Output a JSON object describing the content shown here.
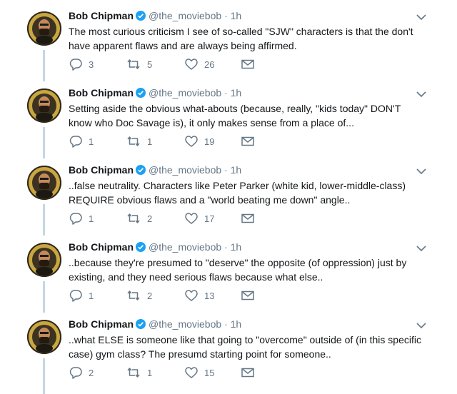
{
  "colors": {
    "accent": "#1da1f2",
    "connector": "#c4d7e4",
    "muted": "#657786"
  },
  "author": {
    "name": "Bob Chipman",
    "handle": "@the_moviebob",
    "separator": "·"
  },
  "icons": {
    "reply": "reply-icon",
    "retweet": "retweet-icon",
    "like": "heart-icon",
    "dm": "envelope-icon",
    "verified": "verified-badge-icon",
    "caret": "chevron-down-icon"
  },
  "tweets": [
    {
      "time": "1h",
      "text": "The most curious criticism I see of so-called \"SJW\" characters is that the don't have apparent flaws and are always being affirmed.",
      "replies": "3",
      "retweets": "5",
      "likes": "26"
    },
    {
      "time": "1h",
      "text": "Setting aside the obvious what-abouts (because, really, \"kids today\" DON'T know who Doc Savage is), it only makes sense from a place of...",
      "replies": "1",
      "retweets": "1",
      "likes": "19"
    },
    {
      "time": "1h",
      "text": "..false neutrality. Characters like Peter Parker (white kid, lower-middle-class) REQUIRE obvious flaws and a \"world beating me down\" angle..",
      "replies": "1",
      "retweets": "2",
      "likes": "17"
    },
    {
      "time": "1h",
      "text": "..because they're presumed to \"deserve\" the opposite (of oppression) just by existing, and they need serious flaws because what else..",
      "replies": "1",
      "retweets": "2",
      "likes": "13"
    },
    {
      "time": "1h",
      "text": "..what ELSE is someone like that going to \"overcome\" outside of (in this specific case) gym class? The presumd starting point for someone..",
      "replies": "2",
      "retweets": "1",
      "likes": "15"
    }
  ]
}
